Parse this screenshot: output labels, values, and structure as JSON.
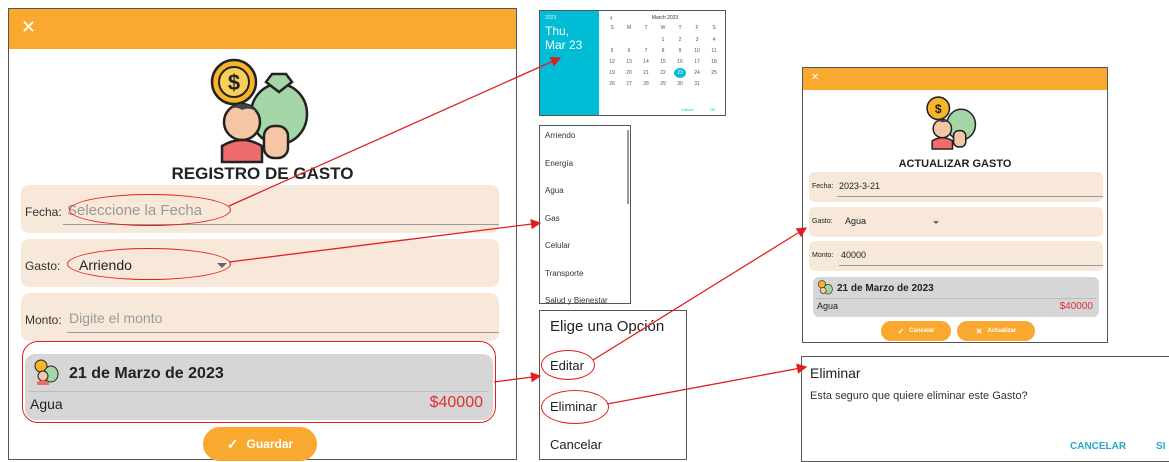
{
  "main_form": {
    "close_glyph": "✕",
    "title": "REGISTRO DE GASTO",
    "fecha_label": "Fecha:",
    "fecha_placeholder": "Seleccione la Fecha",
    "gasto_label": "Gasto:",
    "gasto_value": "Arriendo",
    "monto_label": "Monto:",
    "monto_placeholder": "Digite el monto",
    "card_date": "21 de Marzo de 2023",
    "card_category": "Agua",
    "card_amount": "$40000",
    "save_label": "Guardar"
  },
  "calendar": {
    "year": "2023",
    "weekday": "Thu,",
    "date": "Mar 23",
    "month_title": "March 2023",
    "nav_prev": "‹",
    "weekdays": [
      "S",
      "M",
      "T",
      "W",
      "T",
      "F",
      "S"
    ],
    "days": [
      "",
      "",
      "",
      "1",
      "2",
      "3",
      "4",
      "5",
      "6",
      "7",
      "8",
      "9",
      "10",
      "11",
      "12",
      "13",
      "14",
      "15",
      "16",
      "17",
      "18",
      "19",
      "20",
      "21",
      "22",
      "23",
      "24",
      "25",
      "26",
      "27",
      "28",
      "29",
      "30",
      "31",
      ""
    ],
    "selected_day": "23",
    "cancel_label": "Cancel",
    "ok_label": "OK"
  },
  "dropdown": {
    "items": [
      "Arriendo",
      "Energía",
      "Agua",
      "Gas",
      "Celular",
      "Transporte",
      "Salud y Bienestar"
    ]
  },
  "options_dialog": {
    "title": "Elige una Opción",
    "items": [
      "Editar",
      "Eliminar",
      "Cancelar"
    ]
  },
  "update_form": {
    "close_glyph": "✕",
    "title": "ACTUALIZAR GASTO",
    "fecha_label": "Fecha:",
    "fecha_value": "2023-3-21",
    "gasto_label": "Gasto:",
    "gasto_value": "Agua",
    "monto_label": "Monto:",
    "monto_value": "40000",
    "card_date": "21 de Marzo de 2023",
    "card_category": "Agua",
    "card_amount": "$40000",
    "cancel_label": "Cancelar",
    "update_label": "Actualizar"
  },
  "delete_dialog": {
    "title": "Eliminar",
    "message": "Esta seguro que quiere eliminar este Gasto?",
    "cancel_label": "CANCELAR",
    "confirm_label": "SI"
  },
  "colors": {
    "accent": "#f9a830",
    "calendar_teal": "#00bcd4",
    "price_red": "#e03030",
    "annotation_red": "#e02020"
  }
}
